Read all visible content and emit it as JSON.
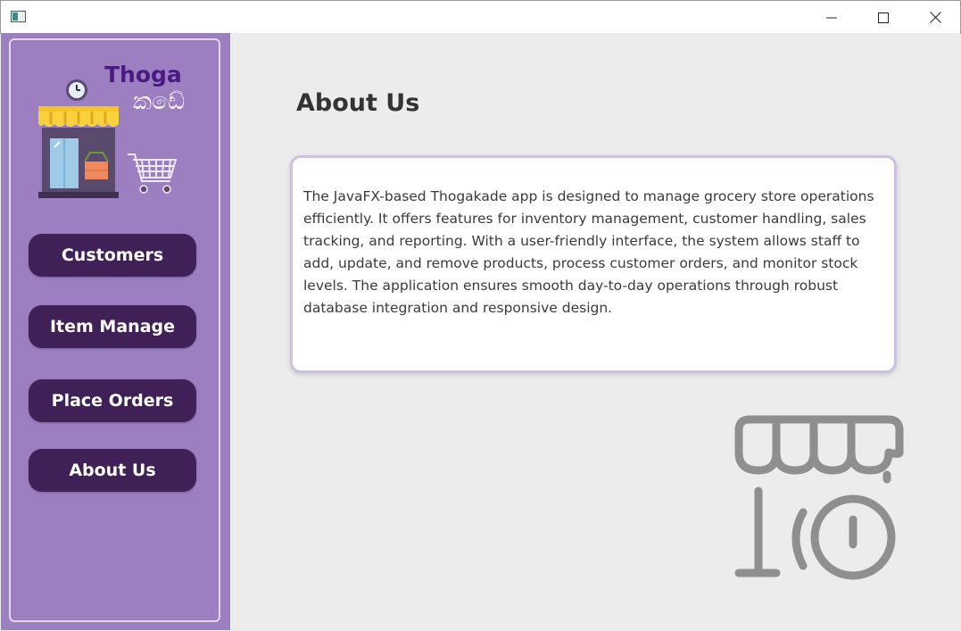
{
  "window": {
    "icon": "app-window-icon",
    "controls": [
      "minimize-icon",
      "maximize-icon",
      "close-icon"
    ]
  },
  "sidebar": {
    "logo": {
      "text": "Thoga",
      "script_text": "කඩේ",
      "icon": "grocery-store-logo"
    },
    "items": [
      {
        "label": "Customers"
      },
      {
        "label": "Item Manage"
      },
      {
        "label": "Place Orders"
      },
      {
        "label": "About Us"
      }
    ]
  },
  "main": {
    "title": "About Us",
    "description": "The JavaFX-based Thogakade app is designed to manage grocery store operations efficiently. It offers features for inventory management, customer handling, sales tracking, and reporting. With a user-friendly interface, the system allows staff to add, update, and remove products, process customer orders, and monitor stock levels. The application ensures smooth day-to-day operations through robust database integration and responsive design.",
    "decoration_icon": "store-outline-icon"
  },
  "colors": {
    "sidebar_bg": "#9b7fc1",
    "button_bg": "#3f2057",
    "card_border": "#cfc0e2",
    "logo_text": "#4a1a82",
    "main_bg": "#ececec"
  }
}
